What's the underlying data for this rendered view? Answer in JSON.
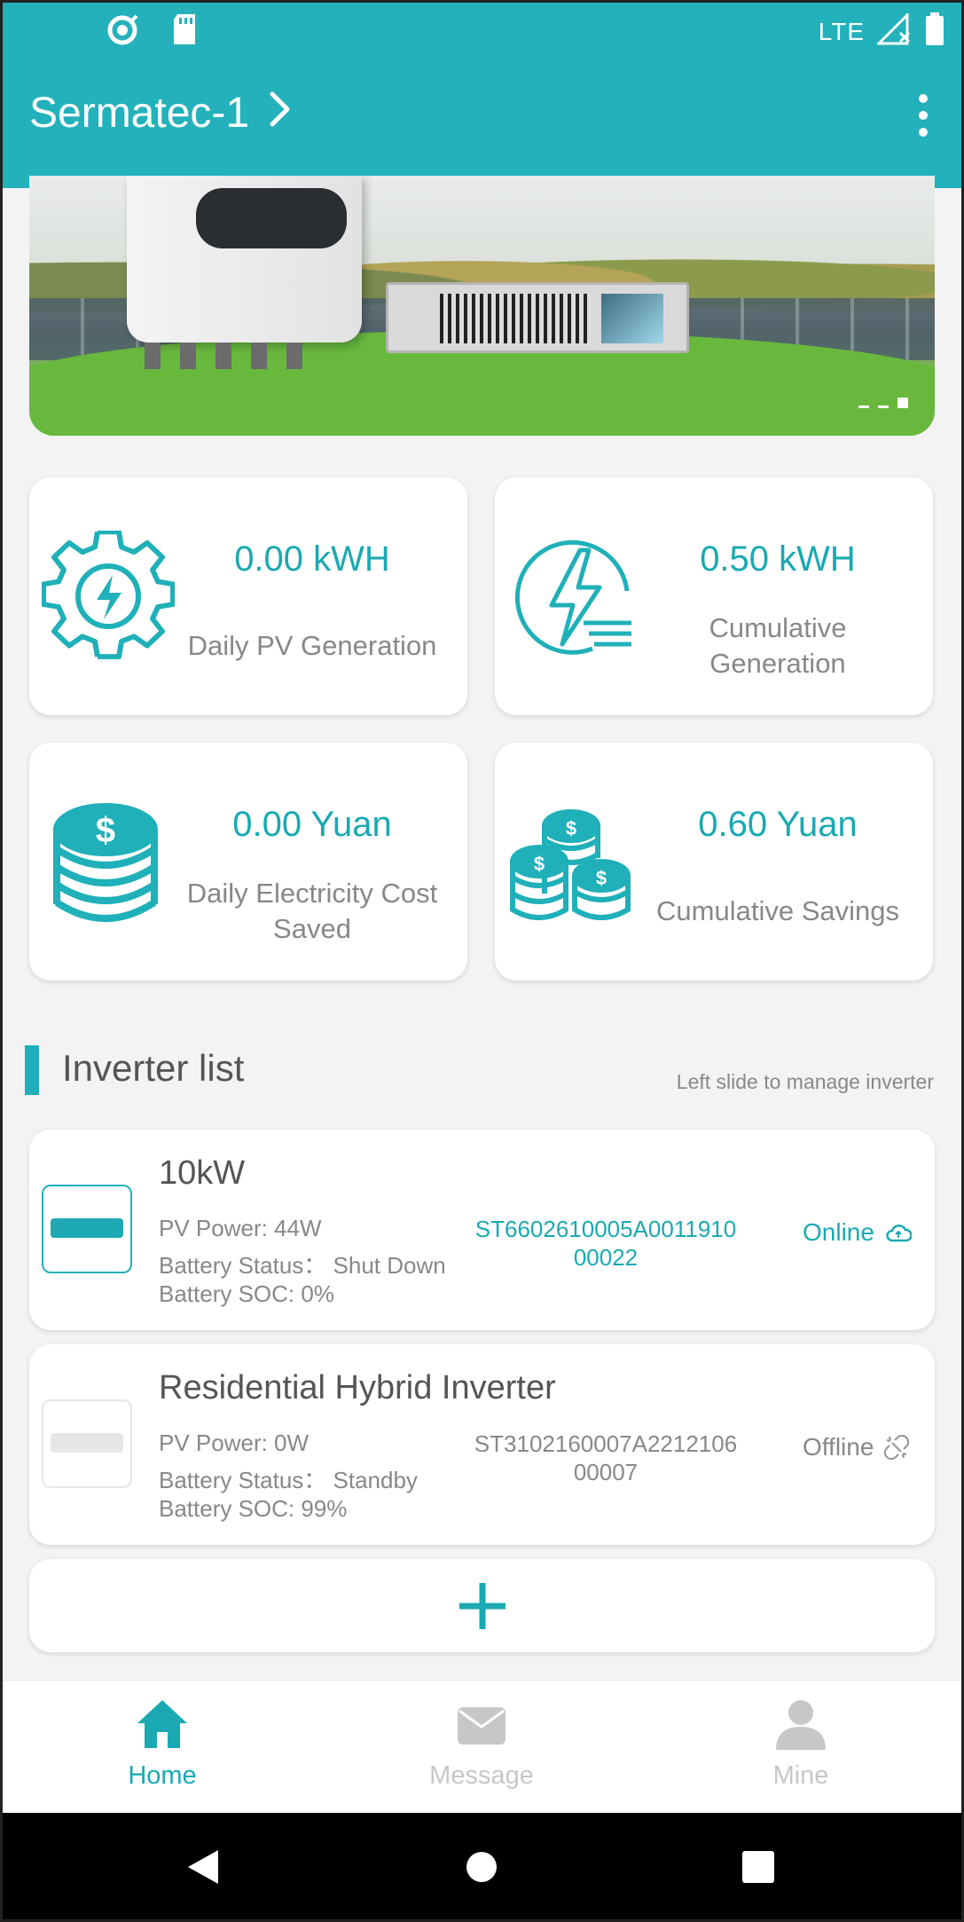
{
  "status_bar": {
    "network": "LTE",
    "icons": [
      "sync-icon",
      "sd-card-icon",
      "signal-icon",
      "battery-icon"
    ]
  },
  "header": {
    "title": "Sermatec-1",
    "background_color": "#23b1bb"
  },
  "banner": {
    "page_count": 3,
    "active_page": 3
  },
  "stats": [
    {
      "value": "0.00",
      "unit": "kWH",
      "label": "Daily PV Generation",
      "icon": "gear-bolt-icon"
    },
    {
      "value": "0.50",
      "unit": "kWH",
      "label": "Cumulative Generation",
      "label_lines": [
        "Cumulative",
        "Generation"
      ],
      "icon": "power-bolt-icon"
    },
    {
      "value": "0.00",
      "unit": "Yuan",
      "label": "Daily Electricity Cost Saved",
      "label_lines": [
        "Daily Electricity Cost",
        "Saved"
      ],
      "icon": "coin-stack-icon"
    },
    {
      "value": "0.60",
      "unit": "Yuan",
      "label": "Cumulative Savings",
      "icon": "coins-piles-icon"
    }
  ],
  "inverter_section": {
    "title": "Inverter list",
    "hint": "Left slide to manage inverter"
  },
  "inverters": [
    {
      "name": "10kW",
      "pv_power": "PV Power: 44W",
      "battery_status": "Battery Status： Shut Down",
      "battery_soc": "Battery SOC: 0%",
      "serial": "ST6602610005A001191000022",
      "status": "Online",
      "status_icon": "cloud-icon"
    },
    {
      "name": "Residential Hybrid Inverter",
      "pv_power": "PV Power: 0W",
      "battery_status": "Battery Status： Standby",
      "battery_soc": "Battery SOC: 99%",
      "serial": "ST3102160007A221210600007",
      "status": "Offline",
      "status_icon": "broken-link-icon"
    }
  ],
  "bottom_nav": [
    {
      "label": "Home",
      "icon": "home-icon",
      "active": true
    },
    {
      "label": "Message",
      "icon": "envelope-icon",
      "active": false
    },
    {
      "label": "Mine",
      "icon": "person-icon",
      "active": false
    }
  ],
  "colors": {
    "accent": "#1aa9b2",
    "muted_text": "#888888",
    "inactive_nav": "#c7c7c7"
  }
}
